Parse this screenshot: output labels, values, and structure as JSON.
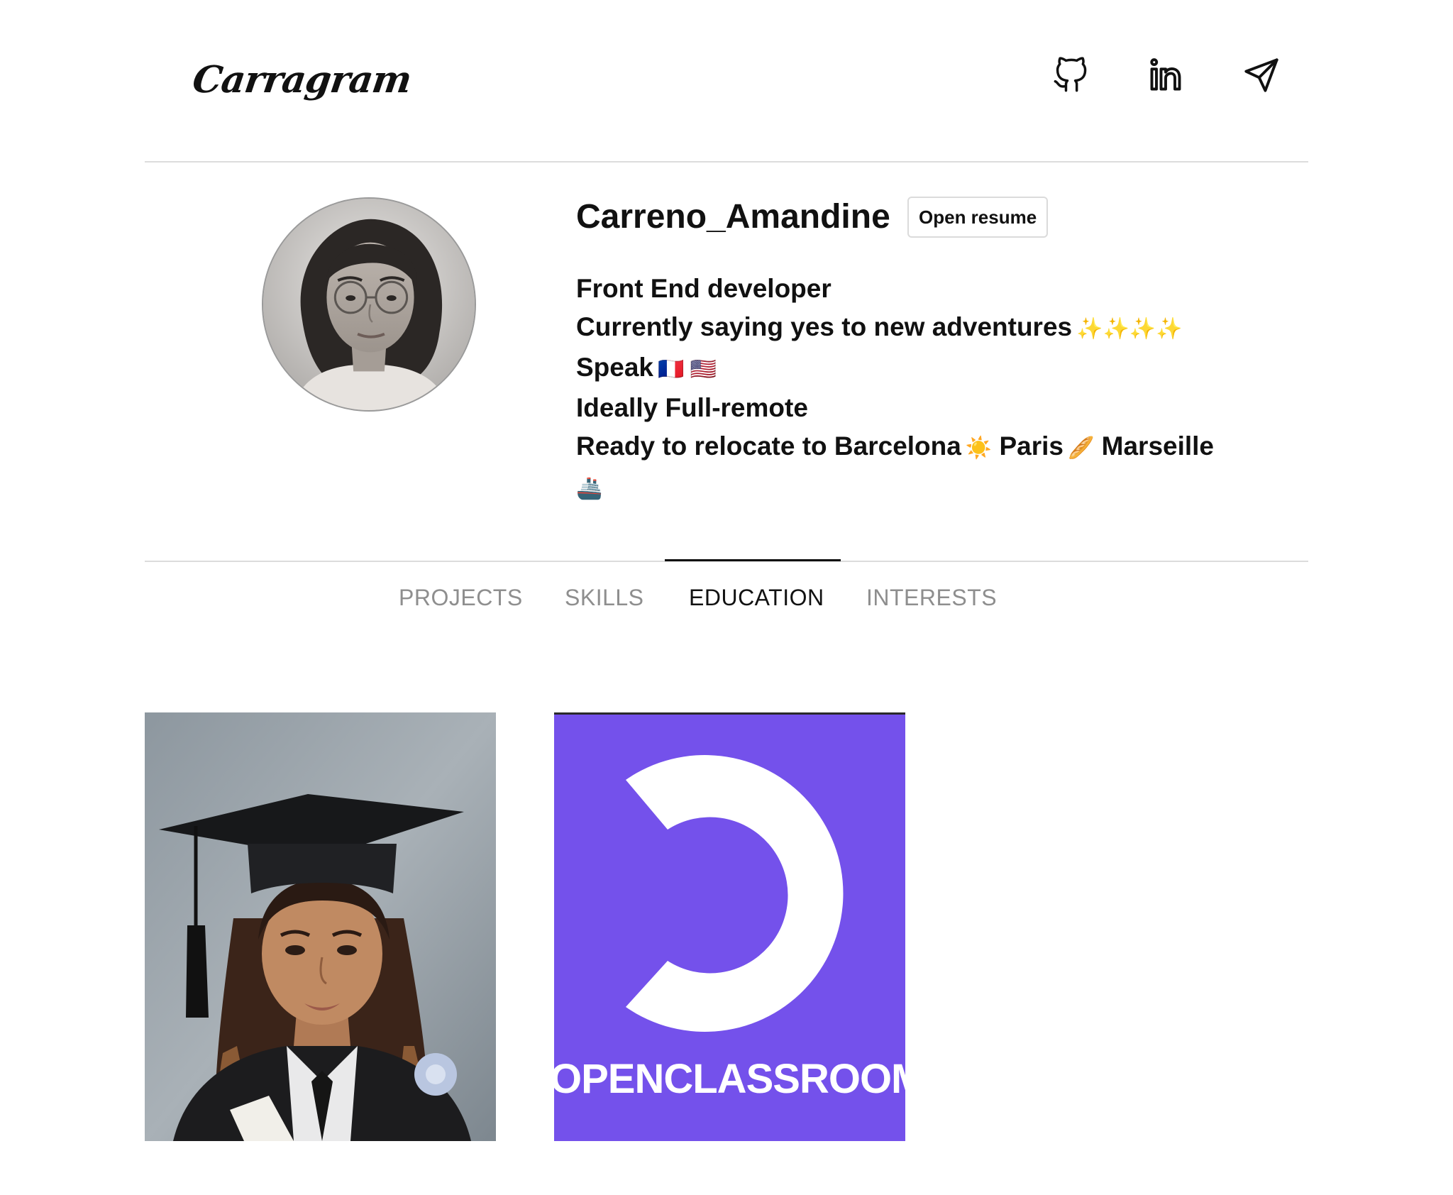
{
  "header": {
    "logo": "Carragram",
    "icons": [
      "github-icon",
      "linkedin-icon",
      "send-icon"
    ]
  },
  "profile": {
    "username": "Carreno_Amandine",
    "resume_button": "Open resume",
    "bio": {
      "line1": "Front End developer",
      "line2": "Currently saying yes to new adventures",
      "line2_emoji": "✨✨✨✨",
      "line3": "Speak",
      "line3_flags": "🇫🇷 🇺🇸",
      "line4": "Ideally Full-remote",
      "line5_a": "Ready to relocate to Barcelona",
      "line5_a_emoji": "☀️",
      "line5_b": "Paris",
      "line5_b_emoji": "🥖",
      "line5_c": "Marseille",
      "line5_c_emoji": "🚢"
    }
  },
  "tabs": [
    {
      "label": "PROJECTS",
      "active": false
    },
    {
      "label": "SKILLS",
      "active": false
    },
    {
      "label": "EDUCATION",
      "active": true
    },
    {
      "label": "INTERESTS",
      "active": false
    }
  ],
  "education": {
    "cards": [
      {
        "type": "photo",
        "subject": "graduation-portrait"
      },
      {
        "type": "logo",
        "brand_text": "OPENCLASSROOMS",
        "bg_color": "#7451eb"
      }
    ]
  },
  "colors": {
    "text": "#111111",
    "muted_tab": "#8e8e8e",
    "divider": "#dcdcdc",
    "openclassrooms_purple": "#7451eb"
  }
}
